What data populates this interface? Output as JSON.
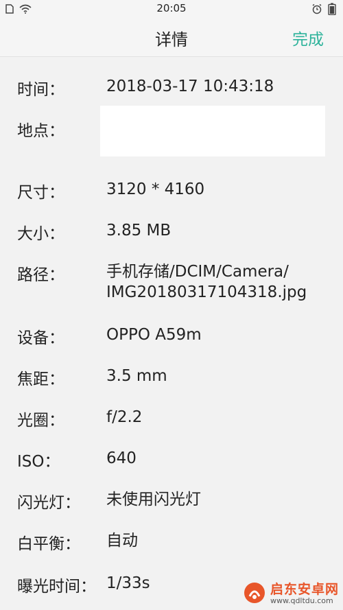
{
  "status_bar": {
    "time": "20:05",
    "icons": [
      "sim-icon",
      "wifi-icon",
      "alarm-icon",
      "battery-icon"
    ]
  },
  "nav": {
    "title": "详情",
    "done_label": "完成"
  },
  "details": [
    {
      "label": "时间：",
      "value_lines": [
        "2018-03-17 10:43:18"
      ]
    },
    {
      "label": "地点：",
      "value_lines": []
    },
    {
      "label": "尺寸：",
      "value_lines": [
        "3120 * 4160"
      ]
    },
    {
      "label": "大小：",
      "value_lines": [
        "3.85 MB"
      ]
    },
    {
      "label": "路径：",
      "value_lines": [
        "手机存储/DCIM/Camera/",
        "IMG20180317104318.jpg"
      ]
    },
    {
      "label": "设备：",
      "value_lines": [
        "OPPO A59m"
      ]
    },
    {
      "label": "焦距：",
      "value_lines": [
        "3.5 mm"
      ]
    },
    {
      "label": "光圈：",
      "value_lines": [
        "f/2.2"
      ]
    },
    {
      "label": "ISO：",
      "value_lines": [
        "640"
      ]
    },
    {
      "label": "闪光灯：",
      "value_lines": [
        "未使用闪光灯"
      ]
    },
    {
      "label": "白平衡：",
      "value_lines": [
        "自动"
      ]
    },
    {
      "label": "曝光时间：",
      "value_lines": [
        "1/33s"
      ]
    }
  ],
  "watermark": {
    "title": "启东安卓网",
    "url": "www.qdltdu.com"
  },
  "colors": {
    "accent": "#2eb39b",
    "background": "#f2f2f2",
    "watermark": "#e8562a"
  }
}
